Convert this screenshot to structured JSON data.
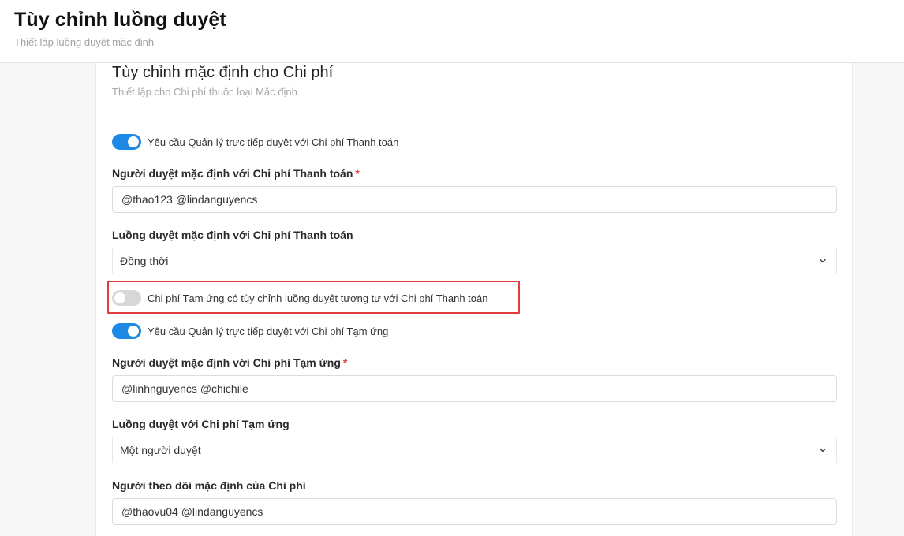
{
  "header": {
    "title": "Tùy chỉnh luồng duyệt",
    "subtitle": "Thiết lập luồng duyệt mặc định"
  },
  "card": {
    "title": "Tùy chỉnh mặc định cho Chi phí",
    "subtitle": "Thiết lập cho Chi phí thuộc loại Mặc định"
  },
  "settings": {
    "toggle_manager_payment": {
      "label": "Yêu cầu Quản lý trực tiếp duyệt với Chi phí Thanh toán",
      "on": true
    },
    "payment_approvers": {
      "label": "Người duyệt mặc định với Chi phí Thanh toán",
      "required_mark": "*",
      "value": "@thao123 @lindanguyencs"
    },
    "payment_flow": {
      "label": "Luồng duyệt mặc định với Chi phí Thanh toán",
      "value": "Đồng thời"
    },
    "toggle_advance_same": {
      "label": "Chi phí Tạm ứng có tùy chỉnh luồng duyệt tương tự với Chi phí Thanh toán",
      "on": false
    },
    "toggle_manager_advance": {
      "label": "Yêu cầu Quản lý trực tiếp duyệt với Chi phí Tạm ứng",
      "on": true
    },
    "advance_approvers": {
      "label": "Người duyệt mặc định với Chi phí Tạm ứng",
      "required_mark": "*",
      "value": "@linhnguyencs @chichile"
    },
    "advance_flow": {
      "label": "Luồng duyệt với Chi phí Tạm ứng",
      "value": "Một người duyệt"
    },
    "default_followers": {
      "label": "Người theo dõi mặc định của Chi phí",
      "value": "@thaovu04 @lindanguyencs"
    }
  },
  "colors": {
    "toggle_on": "#1e88e5",
    "toggle_off": "#d7d7da",
    "required": "#e53935",
    "highlight": "#e23b3b"
  }
}
